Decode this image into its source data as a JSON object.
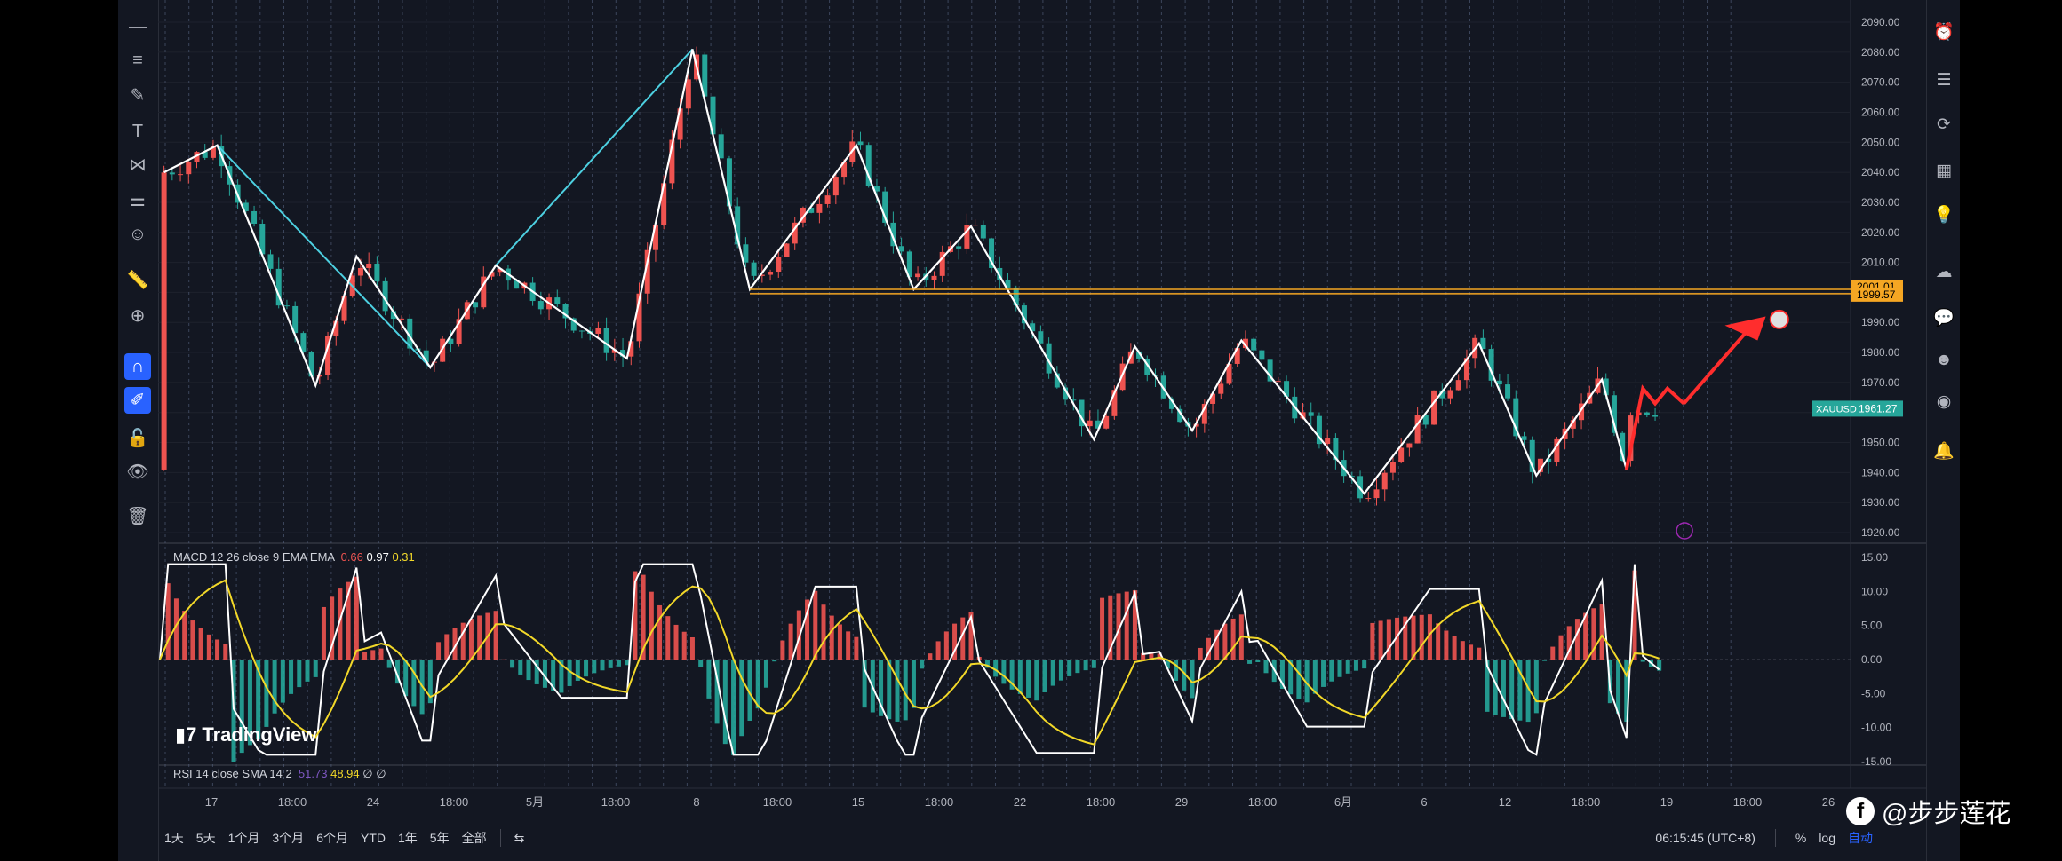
{
  "window": {
    "left_tools_count": 15
  },
  "toolbar": {
    "tools": [
      {
        "name": "crosshair-icon",
        "glyph": "—"
      },
      {
        "name": "trendline-icon",
        "glyph": "≡"
      },
      {
        "name": "brush-icon",
        "glyph": "✎"
      },
      {
        "name": "text-icon",
        "glyph": "T"
      },
      {
        "name": "pattern-icon",
        "glyph": "⋈"
      },
      {
        "name": "forecast-icon",
        "glyph": "⚌"
      },
      {
        "name": "emoji-icon",
        "glyph": "☺"
      },
      {
        "name": "ruler-icon",
        "glyph": "📏"
      },
      {
        "name": "zoom-icon",
        "glyph": "⊕"
      },
      {
        "name": "magnet-icon",
        "glyph": "∩",
        "active": true
      },
      {
        "name": "stay-drawing-icon",
        "glyph": "✐",
        "active": true
      },
      {
        "name": "lock-icon",
        "glyph": "🔓"
      },
      {
        "name": "visibility-icon",
        "glyph": "👁"
      },
      {
        "name": "trash-icon",
        "glyph": "🗑"
      }
    ]
  },
  "rightbar": {
    "tools": [
      "alarm-icon",
      "watchlist-icon",
      "replay-icon",
      "calendar-icon",
      "ideas-icon",
      "cloud-icon",
      "chat-icon",
      "community-icon",
      "broadcast-icon",
      "notifications-icon"
    ]
  },
  "chart_data": {
    "type": "candlestick",
    "symbol": "XAUUSD",
    "last_price": "1961.27",
    "price_axis": {
      "ticks": [
        "2090.00",
        "2080.00",
        "2070.00",
        "2060.00",
        "2050.00",
        "2040.00",
        "2030.00",
        "2020.00",
        "2010.00",
        "2000.00",
        "1990.00",
        "1980.00",
        "1970.00",
        "1960.00",
        "1950.00",
        "1940.00",
        "1930.00",
        "1920.00"
      ],
      "ylim": [
        1920,
        2090
      ]
    },
    "horizontal_levels": [
      {
        "value": 2001.01,
        "label": "2001.01",
        "color": "#f5a623"
      },
      {
        "value": 1999.57,
        "label": "1999.57",
        "color": "#f5a623"
      }
    ],
    "time_axis": [
      "17",
      "18:00",
      "24",
      "18:00",
      "5月",
      "18:00",
      "8",
      "18:00",
      "15",
      "18:00",
      "22",
      "18:00",
      "29",
      "18:00",
      "6月",
      "6",
      "12",
      "18:00",
      "19",
      "18:00",
      "26"
    ],
    "zigzag": [
      {
        "t": 0.5,
        "p": 2040
      },
      {
        "t": 7,
        "p": 2049
      },
      {
        "t": 19,
        "p": 1969
      },
      {
        "t": 24,
        "p": 2012
      },
      {
        "t": 33,
        "p": 1975
      },
      {
        "t": 41,
        "p": 2009
      },
      {
        "t": 57,
        "p": 1978
      },
      {
        "t": 65,
        "p": 2081
      },
      {
        "t": 72,
        "p": 2001
      },
      {
        "t": 85,
        "p": 2049
      },
      {
        "t": 92,
        "p": 2001
      },
      {
        "t": 99,
        "p": 2022
      },
      {
        "t": 114,
        "p": 1951
      },
      {
        "t": 119,
        "p": 1982
      },
      {
        "t": 126,
        "p": 1954
      },
      {
        "t": 132,
        "p": 1984
      },
      {
        "t": 147,
        "p": 1933
      },
      {
        "t": 161,
        "p": 1983
      },
      {
        "t": 168,
        "p": 1939
      },
      {
        "t": 176,
        "p": 1971
      },
      {
        "t": 179,
        "p": 1941
      }
    ],
    "macd": {
      "label": "MACD 12 26 close 9 EMA EMA",
      "values": [
        "0.66",
        "0.97",
        "0.31"
      ],
      "axis_ticks": [
        "15.00",
        "10.00",
        "5.00",
        "0.00",
        "-5.00",
        "-10.00",
        "-15.00"
      ],
      "ylim": [
        -15,
        15
      ]
    },
    "rsi": {
      "label": "RSI 14 close SMA 14 2",
      "values": [
        "51.73",
        "48.94",
        "∅",
        "∅"
      ]
    }
  },
  "bottom_bar": {
    "ranges": [
      "1天",
      "5天",
      "1个月",
      "3个月",
      "6个月",
      "YTD",
      "1年",
      "5年",
      "全部"
    ],
    "time": "06:15:45 (UTC+8)",
    "percent": "%",
    "log": "log",
    "auto": "自动"
  },
  "branding": {
    "logo_text": "TradingView"
  },
  "watermark": {
    "text": "@步步莲花"
  },
  "colors": {
    "up": "#ef5350",
    "down": "#26a69a",
    "background": "#131722",
    "macd_line": "#ffffff",
    "signal_line": "#f2d829",
    "accent": "#2962ff"
  }
}
